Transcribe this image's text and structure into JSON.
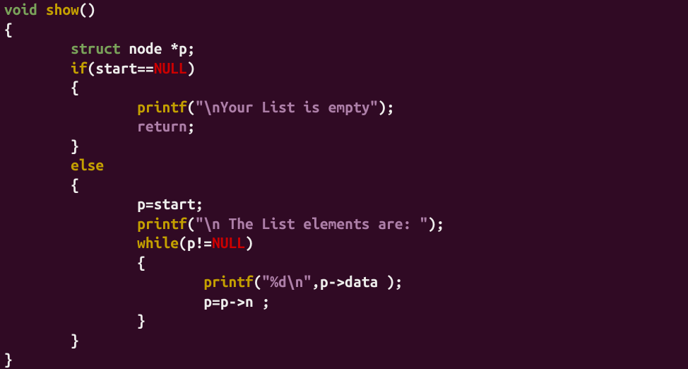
{
  "tokens": {
    "void": "void",
    "struct": "struct",
    "show": "show",
    "node": "node",
    "p": "p",
    "if": "if",
    "start": "start",
    "eqeq": "==",
    "null": "NULL",
    "printf": "printf",
    "str_empty": "\"\\nYour List is empty\"",
    "return": "return",
    "else": "else",
    "assign_start": "p=start;",
    "str_elems": "\"\\n The List elements are: \"",
    "while": "while",
    "neq": "!=",
    "str_fmt": "\"%d\\n\"",
    "pdata": ",p->data );",
    "pnext": "p=p->n ;",
    "lbrace": "{",
    "rbrace": "}",
    "lparen": "(",
    "rparen": ")",
    "star": "*",
    "semi": ";",
    "rparen_semi": ");",
    "unit_parens": "()",
    "sp1": " ",
    "indent1": "        ",
    "indent2": "                ",
    "indent3": "                        "
  }
}
